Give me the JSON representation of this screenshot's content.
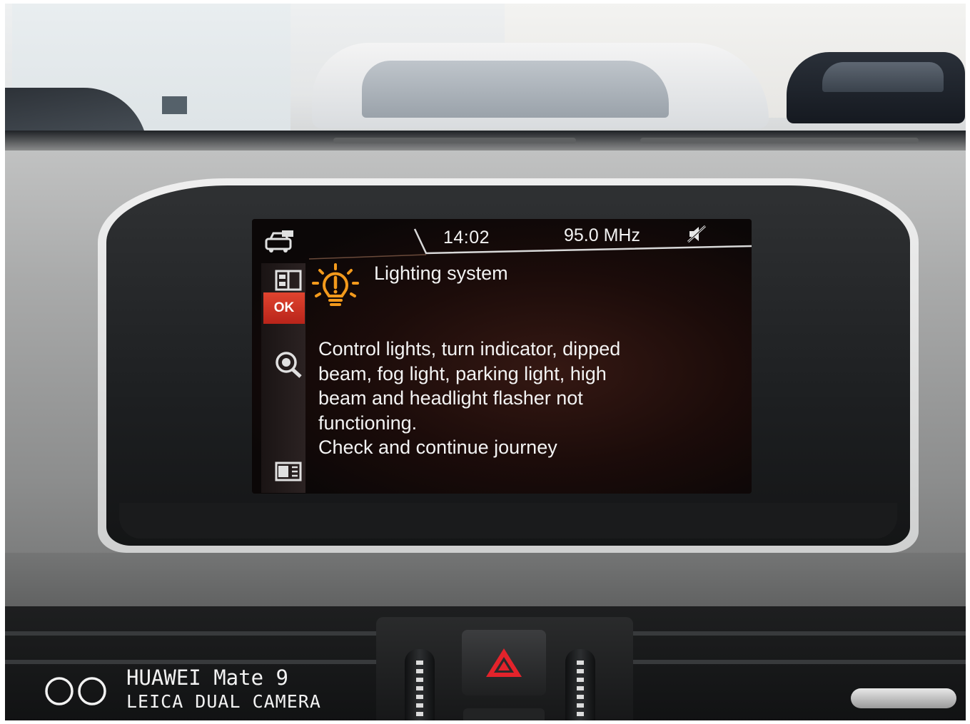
{
  "screen": {
    "status_bar": {
      "time": "14:02",
      "radio": "95.0 MHz",
      "mute_icon": "mute-icon"
    },
    "left_rail": {
      "top_icon": "car-status-icon",
      "items": [
        {
          "icon": "vehicle-info-icon"
        },
        {
          "label": "OK"
        },
        {
          "icon": "search-service-icon"
        },
        {
          "icon": "menu-toggle-icon"
        }
      ]
    },
    "message": {
      "icon": "lighting-warning-icon",
      "icon_color": "#f39a1c",
      "title": "Lighting system",
      "body": "Control lights, turn indicator, dipped\nbeam, fog light, parking light, high\nbeam and headlight flasher not\nfunctioning.\nCheck and continue journey"
    },
    "accent_color": "#d8341f"
  },
  "dashboard": {
    "hazard_icon": "hazard-triangle-icon",
    "hazard_color": "#e3232b"
  },
  "watermark": {
    "line1": "HUAWEI Mate 9",
    "line2": "LEICA DUAL CAMERA"
  }
}
